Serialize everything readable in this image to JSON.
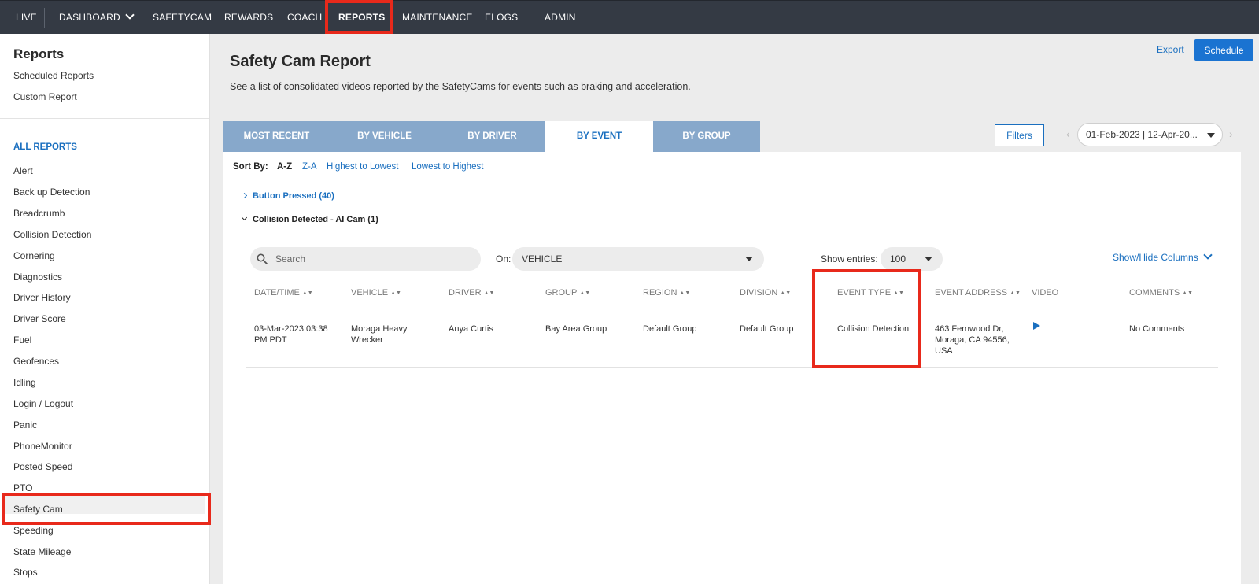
{
  "nav": {
    "items": [
      "LIVE",
      "DASHBOARD",
      "SAFETYCAM",
      "REWARDS",
      "COACH",
      "REPORTS",
      "MAINTENANCE",
      "ELOGS",
      "ADMIN"
    ]
  },
  "sidebar": {
    "title": "Reports",
    "top_links": [
      "Scheduled Reports",
      "Custom Report"
    ],
    "section_title": "ALL REPORTS",
    "items": [
      "Alert",
      "Back up Detection",
      "Breadcrumb",
      "Collision Detection",
      "Cornering",
      "Diagnostics",
      "Driver History",
      "Driver Score",
      "Fuel",
      "Geofences",
      "Idling",
      "Login / Logout",
      "Panic",
      "PhoneMonitor",
      "Posted Speed",
      "PTO",
      "Safety Cam",
      "Speeding",
      "State Mileage",
      "Stops"
    ],
    "selected": "Safety Cam"
  },
  "header": {
    "title": "Safety Cam Report",
    "description": "See a list of consolidated videos reported by the SafetyCams for events such as braking and acceleration.",
    "export_label": "Export",
    "schedule_label": "Schedule"
  },
  "tabs": [
    "MOST RECENT",
    "BY VEHICLE",
    "BY DRIVER",
    "BY EVENT",
    "BY GROUP"
  ],
  "active_tab": "BY EVENT",
  "filters_label": "Filters",
  "date_range": "01-Feb-2023 | 12-Apr-20...",
  "sort": {
    "label": "Sort By:",
    "options": [
      "A-Z",
      "Z-A",
      "Highest to Lowest",
      "Lowest to Highest"
    ],
    "active": "A-Z"
  },
  "groups": [
    "Button Pressed (40)",
    "Collision Detected - AI Cam (1)"
  ],
  "controls": {
    "search_placeholder": "Search",
    "on_label": "On:",
    "on_value": "VEHICLE",
    "entries_label": "Show entries:",
    "entries_value": "100",
    "show_hide_label": "Show/Hide Columns"
  },
  "table": {
    "columns": [
      "DATE/TIME",
      "VEHICLE",
      "DRIVER",
      "GROUP",
      "REGION",
      "DIVISION",
      "EVENT TYPE",
      "EVENT ADDRESS",
      "VIDEO",
      "COMMENTS"
    ],
    "rows": [
      {
        "datetime": "03-Mar-2023 03:38 PM PDT",
        "vehicle": "Moraga Heavy Wrecker",
        "driver": "Anya Curtis",
        "group": "Bay Area Group",
        "region": "Default Group",
        "division": "Default Group",
        "event_type": "Collision Detection",
        "address": "463 Fernwood Dr, Moraga, CA 94556, USA",
        "comments": "No Comments"
      }
    ]
  },
  "colors": {
    "nav_bg": "#343a44",
    "accent": "#1a6fbf",
    "tab_bg": "#87a8cb",
    "highlight": "#e8291b"
  }
}
